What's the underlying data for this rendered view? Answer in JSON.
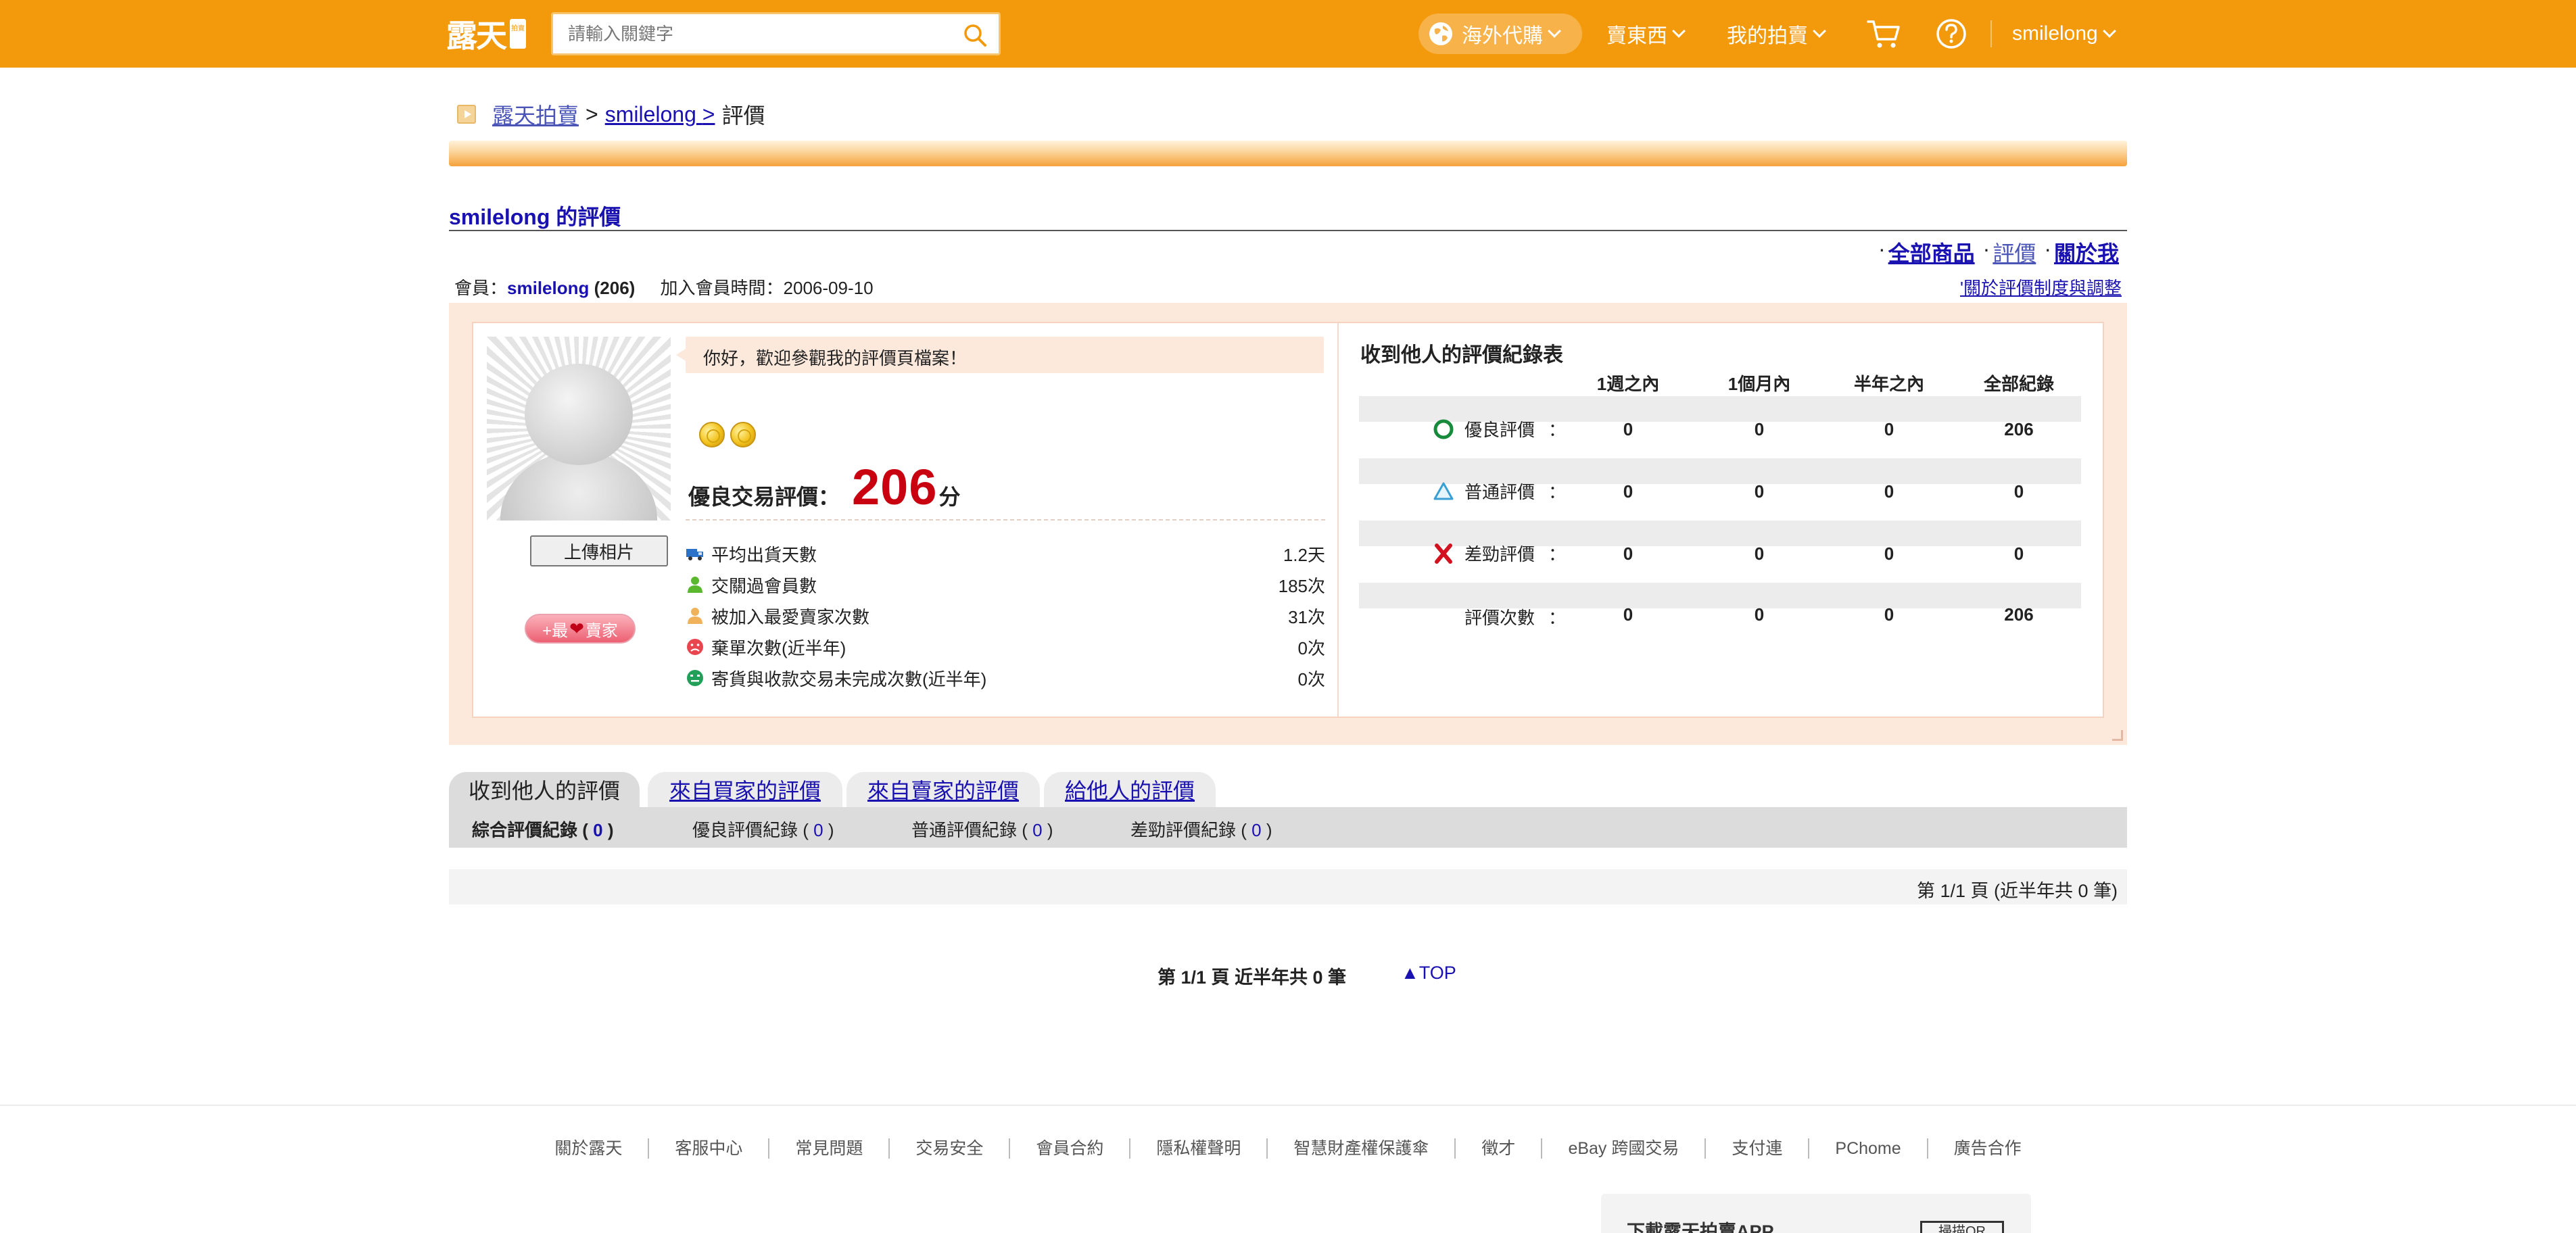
{
  "header": {
    "logo_text": "露天",
    "logo_badge": "拍賣",
    "search_placeholder": "請輸入關鍵字",
    "overseas_label": "海外代購",
    "sell_label": "賣東西",
    "my_auction_label": "我的拍賣",
    "username": "smilelong",
    "icons": {
      "search": "search-icon",
      "cart": "cart-icon",
      "help": "help-icon",
      "globe": "globe-icon"
    },
    "colors": {
      "bar": "#f39a0c"
    }
  },
  "breadcrumb": {
    "root": "露天拍賣",
    "sep1": ">",
    "user": "smilelong",
    "sep2": ">",
    "current": "評價"
  },
  "page": {
    "title": "smilelong 的評價",
    "links": [
      "全部商品",
      "評價",
      "關於我"
    ],
    "member_label": "會員：",
    "member_name": "smilelong",
    "member_count": "(206)",
    "joined": "加入會員時間：2006-09-10",
    "about_rule": "關於評價制度與調整"
  },
  "profile": {
    "upload_button": "上傳相片",
    "favorite_button_left": "+最",
    "favorite_button_right": "賣家",
    "greeting": "你好，歡迎參觀我的評價頁檔案！",
    "coins": 2,
    "score_label": "優良交易評價：",
    "score_value": "206",
    "score_unit": "分",
    "stats": [
      {
        "label": "平均出貨天數",
        "value": "1.2天",
        "icon": "truck-icon"
      },
      {
        "label": "交關過會員數",
        "value": "185次",
        "icon": "member-icon"
      },
      {
        "label": "被加入最愛賣家次數",
        "value": "31次",
        "icon": "favorite-seller-icon"
      },
      {
        "label": "棄單次數(近半年)",
        "value": "0次",
        "icon": "abandon-icon"
      },
      {
        "label": "寄貨與收款交易未完成次數(近半年)",
        "value": "0次",
        "icon": "incomplete-icon"
      }
    ]
  },
  "rating_table": {
    "title": "收到他人的評價紀錄表",
    "columns": [
      "1週之內",
      "1個月內",
      "半年之內",
      "全部紀錄"
    ],
    "rows": [
      {
        "label": "優良評價",
        "colon": "：",
        "icon": "good-circle-icon",
        "values": [
          "0",
          "0",
          "0",
          "206"
        ]
      },
      {
        "label": "普通評價",
        "colon": "：",
        "icon": "neutral-triangle-icon",
        "values": [
          "0",
          "0",
          "0",
          "0"
        ]
      },
      {
        "label": "差勁評價",
        "colon": "：",
        "icon": "bad-x-icon",
        "values": [
          "0",
          "0",
          "0",
          "0"
        ]
      },
      {
        "label": "評價次數",
        "colon": "：",
        "icon": "",
        "values": [
          "0",
          "0",
          "0",
          "206"
        ]
      }
    ]
  },
  "tabs": [
    {
      "label": "收到他人的評價",
      "active": true
    },
    {
      "label": "來自買家的評價",
      "active": false
    },
    {
      "label": "來自賣家的評價",
      "active": false
    },
    {
      "label": "給他人的評價",
      "active": false
    }
  ],
  "subtabs": [
    {
      "label": "綜合評價紀錄",
      "count": "0",
      "active": true
    },
    {
      "label": "優良評價紀錄",
      "count": "0",
      "active": false
    },
    {
      "label": "普通評價紀錄",
      "count": "0",
      "active": false
    },
    {
      "label": "差勁評價紀錄",
      "count": "0",
      "active": false
    }
  ],
  "pager": {
    "top_text": "第 1/1 頁 (近半年共 0 筆)",
    "bottom_text": "第 1/1 頁 近半年共 0 筆",
    "top_link": "▲TOP"
  },
  "footer": {
    "links": [
      "關於露天",
      "客服中心",
      "常見問題",
      "交易安全",
      "會員合約",
      "隱私權聲明",
      "智慧財產權保護傘",
      "徵才",
      "eBay 跨國交易",
      "支付連",
      "PChome",
      "廣告合作"
    ],
    "app_title": "下載露天拍賣APP",
    "app_qr": "掃描QR"
  }
}
